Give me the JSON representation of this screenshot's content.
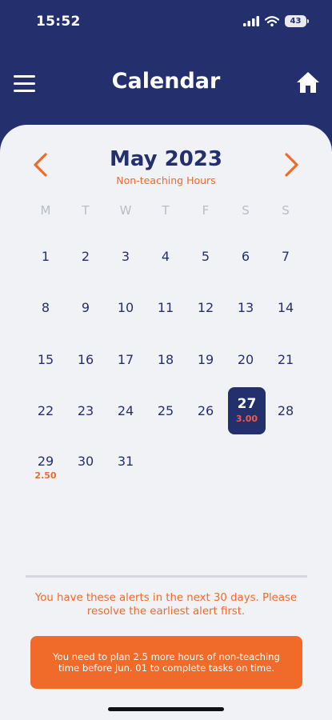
{
  "status_bar": {
    "time": "15:52",
    "battery": "43"
  },
  "header": {
    "title": "Calendar"
  },
  "calendar": {
    "month_title": "May 2023",
    "subtitle": "Non-teaching Hours",
    "weekdays": [
      "M",
      "T",
      "W",
      "T",
      "F",
      "S",
      "S"
    ],
    "days": [
      "1",
      "2",
      "3",
      "4",
      "5",
      "6",
      "7",
      "8",
      "9",
      "10",
      "11",
      "12",
      "13",
      "14",
      "15",
      "16",
      "17",
      "18",
      "19",
      "20",
      "21",
      "22",
      "23",
      "24",
      "25",
      "26",
      "27",
      "28",
      "29",
      "30",
      "31"
    ],
    "selected_day": "27",
    "selected_hours": "3.00",
    "day29_hours": "2.50"
  },
  "alerts": {
    "message": "You have these alerts in the next 30 days. Please resolve the earliest alert first.",
    "button_text": "You need to plan 2.5 more hours of non-teaching time before Jun. 01 to complete tasks on time."
  },
  "colors": {
    "navy": "#24306e",
    "accent_orange": "#f06a2a",
    "card_bg": "#f1f2f6"
  },
  "icons": {
    "menu": "hamburger-icon",
    "home": "home-icon",
    "prev": "chevron-left-icon",
    "next": "chevron-right-icon"
  }
}
